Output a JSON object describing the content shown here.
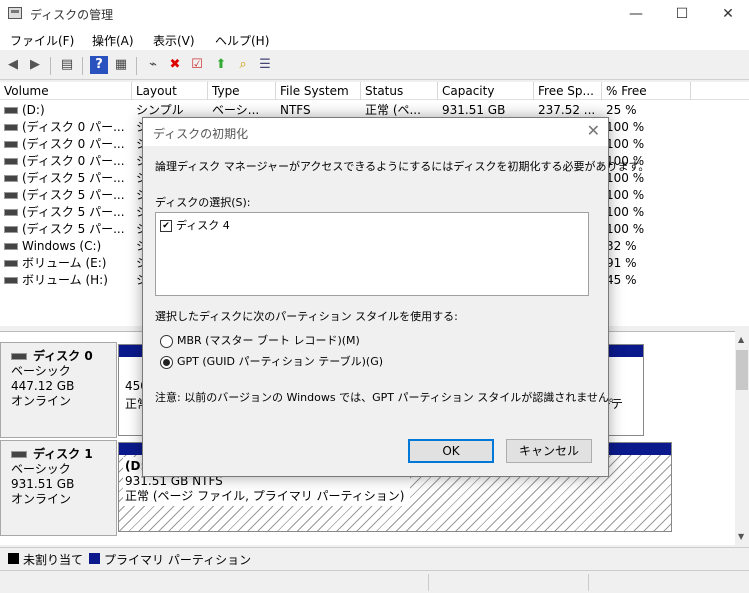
{
  "window": {
    "title": "ディスクの管理",
    "minimize": "—",
    "maximize": "☐",
    "close": "✕"
  },
  "menu": [
    "ファイル(F)",
    "操作(A)",
    "表示(V)",
    "ヘルプ(H)"
  ],
  "toolbar": {
    "icons": [
      "back-icon",
      "forward-icon",
      "list-view-icon",
      "help-icon",
      "properties-icon",
      "connect-icon",
      "delete-icon",
      "check-icon",
      "up-icon",
      "search-icon",
      "settings-icon"
    ]
  },
  "volume_table": {
    "columns": [
      "Volume",
      "Layout",
      "Type",
      "File System",
      "Status",
      "Capacity",
      "Free Sp...",
      "% Free"
    ],
    "rows": [
      [
        "(D:)",
        "シンプル",
        "ベーシ...",
        "NTFS",
        "正常 (ペ...",
        "931.51 GB",
        "237.52 ...",
        "25 %"
      ],
      [
        "(ディスク 0 パー...",
        "シ",
        "",
        "",
        "",
        "",
        "",
        "100 %"
      ],
      [
        "(ディスク 0 パー...",
        "シ",
        "",
        "",
        "",
        "",
        "",
        "100 %"
      ],
      [
        "(ディスク 0 パー...",
        "シ",
        "",
        "",
        "",
        "",
        "",
        "100 %"
      ],
      [
        "(ディスク 5 パー...",
        "シ",
        "",
        "",
        "",
        "",
        "",
        "100 %"
      ],
      [
        "(ディスク 5 パー...",
        "シ",
        "",
        "",
        "",
        "",
        "",
        "100 %"
      ],
      [
        "(ディスク 5 パー...",
        "シ",
        "",
        "",
        "",
        "",
        "",
        "100 %"
      ],
      [
        "(ディスク 5 パー...",
        "シ",
        "",
        "",
        "",
        "",
        "",
        "100 %"
      ],
      [
        "Windows (C:)",
        "シ",
        "",
        "",
        "",
        "",
        "",
        "32 %"
      ],
      [
        "ボリューム (E:)",
        "シ",
        "",
        "",
        "",
        "",
        "",
        "91 %"
      ],
      [
        "ボリューム (H:)",
        "シ",
        "",
        "",
        "",
        "",
        "",
        "45 %"
      ]
    ]
  },
  "disks": [
    {
      "name": "ディスク 0",
      "type": "ベーシック",
      "size": "447.12 GB",
      "status": "オンライン",
      "partition_size": "450",
      "partition_status": "正常",
      "right_text": "ーテ"
    },
    {
      "name": "ディスク 1",
      "type": "ベーシック",
      "size": "931.51 GB",
      "status": "オンライン",
      "partition_name": "(D:)",
      "partition_size": "931.51 GB NTFS",
      "partition_status": "正常 (ページ ファイル, プライマリ パーティション)"
    }
  ],
  "legend": [
    {
      "label": "未割り当て",
      "color": "#000000"
    },
    {
      "label": "プライマリ パーティション",
      "color": "#0a1a8c"
    }
  ],
  "dialog": {
    "title": "ディスクの初期化",
    "message": "論理ディスク マネージャーがアクセスできるようにするにはディスクを初期化する必要があります。",
    "select_label": "ディスクの選択(S):",
    "disks": [
      {
        "label": "ディスク 4",
        "checked": true
      }
    ],
    "style_label": "選択したディスクに次のパーティション スタイルを使用する:",
    "options": [
      {
        "label": "MBR (マスター ブート レコード)(M)",
        "selected": false
      },
      {
        "label": "GPT (GUID パーティション テーブル)(G)",
        "selected": true
      }
    ],
    "note": "注意: 以前のバージョンの Windows では、GPT パーティション スタイルが認識されません。",
    "ok": "OK",
    "cancel": "キャンセル"
  }
}
